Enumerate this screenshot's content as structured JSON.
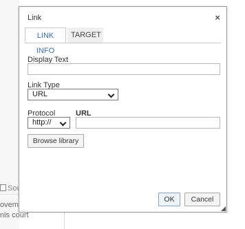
{
  "dialog": {
    "title": "Link",
    "close_glyph": "×",
    "tabs": [
      {
        "label": "LINK INFO",
        "active": true
      },
      {
        "label": "TARGET",
        "active": false
      }
    ]
  },
  "form": {
    "display_text_label": "Display Text",
    "display_text_value": "",
    "link_type_label": "Link Type",
    "link_type_value": "URL",
    "protocol_label": "Protocol",
    "protocol_value": "http://",
    "url_label": "URL",
    "url_value": "",
    "browse_label": "Browse library"
  },
  "buttons": {
    "ok": "OK",
    "cancel": "Cancel"
  },
  "background": {
    "source_label": "Sou",
    "row1": "ovem",
    "row2": "nis court"
  },
  "icons": {
    "close": "close-icon",
    "chevron": "chevron-down-icon",
    "resize": "resize-grip-icon"
  }
}
